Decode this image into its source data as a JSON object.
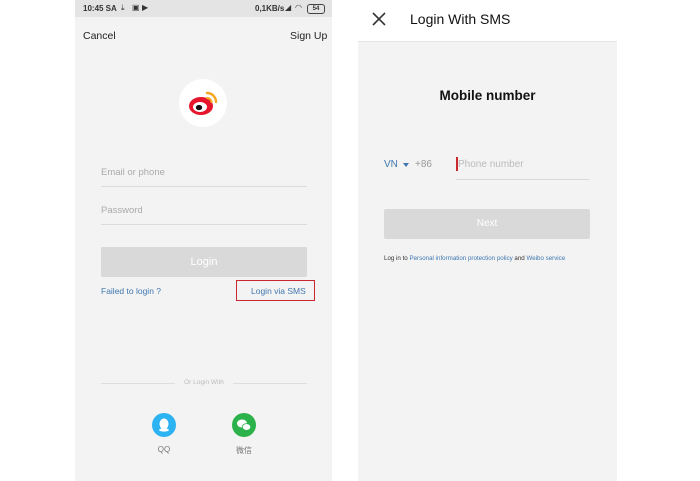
{
  "left_screen": {
    "status_bar": {
      "time": "10:45 SA",
      "network_speed": "0,1KB/s",
      "battery": "54"
    },
    "nav": {
      "cancel_label": "Cancel",
      "signup_label": "Sign Up"
    },
    "form": {
      "email_placeholder": "Email or phone",
      "password_placeholder": "Password",
      "login_label": "Login"
    },
    "links": {
      "failed_label": "Failed to login ?",
      "sms_label": "Login via SMS"
    },
    "social": {
      "divider_label": "Or Login With",
      "items": [
        {
          "label": "QQ",
          "icon": "qq-icon",
          "color": "#2db2f2"
        },
        {
          "label": "微信",
          "icon": "wechat-icon",
          "color": "#2bb24a"
        }
      ]
    },
    "colors": {
      "highlight_box": "#c8282e",
      "link": "#3f77b0",
      "brand": "#e6162d"
    }
  },
  "right_screen": {
    "header": {
      "title": "Login With SMS",
      "close_icon": "close-icon"
    },
    "heading": "Mobile number",
    "phone": {
      "country_code": "VN",
      "prefix": "+86",
      "placeholder": "Phone number"
    },
    "next_label": "Next",
    "terms": {
      "prefix": "Log in to",
      "policy_link": "Personal information protection policy",
      "and": "and",
      "service_link": "Weibo service"
    }
  }
}
